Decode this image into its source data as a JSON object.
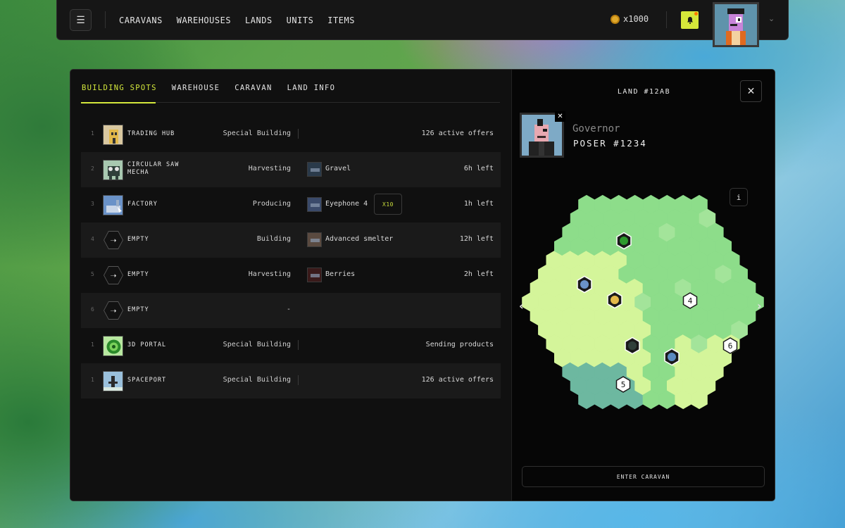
{
  "topbar": {
    "menu_icon": "hamburger-icon",
    "nav": [
      "CARAVANS",
      "WAREHOUSES",
      "LANDS",
      "UNITS",
      "ITEMS"
    ],
    "coins_label": "x1000",
    "coin_icon": "coin-icon",
    "bell_icon": "bell-icon",
    "accent_color": "#d6e83a"
  },
  "tabs": [
    "BUILDING SPOTS",
    "WAREHOUSE",
    "CARAVAN",
    "LAND INFO"
  ],
  "active_tab": "BUILDING SPOTS",
  "spots": [
    {
      "index": "1",
      "name": "TRADING HUB",
      "status": "Special Building",
      "product": "",
      "qty": "",
      "right": "126 active offers",
      "icon": "trading-hub",
      "alt": false
    },
    {
      "index": "2",
      "name": "CIRCULAR SAW MECHA",
      "status": "Harvesting",
      "product": "Gravel",
      "qty": "",
      "right": "6h left",
      "icon": "saw-mecha",
      "alt": true
    },
    {
      "index": "3",
      "name": "FACTORY",
      "status": "Producing",
      "product": "Eyephone 4",
      "qty": "X10",
      "right": "1h left",
      "icon": "factory",
      "alt": false
    },
    {
      "index": "4",
      "name": "EMPTY",
      "status": "Building",
      "product": "Advanced smelter",
      "qty": "",
      "right": "12h left",
      "icon": "empty",
      "alt": true
    },
    {
      "index": "5",
      "name": "EMPTY",
      "status": "Harvesting",
      "product": "Berries",
      "qty": "",
      "right": "2h left",
      "icon": "empty",
      "alt": false
    },
    {
      "index": "6",
      "name": "EMPTY",
      "status": "-",
      "product": "",
      "qty": "",
      "right": "",
      "icon": "empty",
      "alt": true
    },
    {
      "index": "1",
      "name": "3D PORTAL",
      "status": "Special Building",
      "product": "",
      "qty": "",
      "right": "Sending products",
      "icon": "portal",
      "alt": false
    },
    {
      "index": "1",
      "name": "SPACEPORT",
      "status": "Special Building",
      "product": "",
      "qty": "",
      "right": "126 active offers",
      "icon": "spaceport",
      "alt": true
    }
  ],
  "land": {
    "title": "LAND #12AB",
    "governor_role": "Governor",
    "governor_name": "POSER #1234",
    "info_label": "i",
    "map_markers": [
      "4",
      "5",
      "6"
    ],
    "enter_button": "ENTER CARAVAN"
  },
  "colors": {
    "accent": "#d4e83c",
    "map_light": "#d4f59a",
    "map_mid": "#8ddd8a",
    "map_teal": "#6db8a0"
  }
}
